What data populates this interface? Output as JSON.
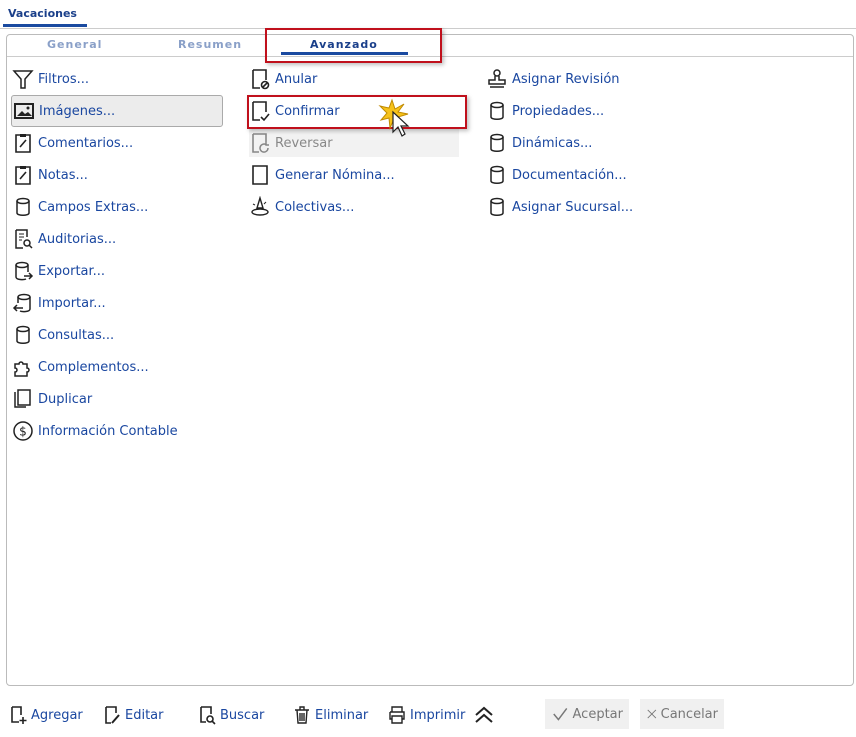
{
  "window_tab": "Vacaciones",
  "tabs": [
    {
      "label": "General"
    },
    {
      "label": "Resumen"
    },
    {
      "label": "Avanzado",
      "active": true
    }
  ],
  "col1": [
    {
      "label": "Filtros...",
      "icon": "filter-icon"
    },
    {
      "label": "Imágenes...",
      "icon": "image-icon"
    },
    {
      "label": "Comentarios...",
      "icon": "clipboard-icon"
    },
    {
      "label": "Notas...",
      "icon": "clipboard-icon"
    },
    {
      "label": "Campos Extras...",
      "icon": "database-icon"
    },
    {
      "label": "Auditorias...",
      "icon": "audit-icon"
    },
    {
      "label": "Exportar...",
      "icon": "database-export-icon"
    },
    {
      "label": "Importar...",
      "icon": "database-import-icon"
    },
    {
      "label": "Consultas...",
      "icon": "database-icon"
    },
    {
      "label": "Complementos...",
      "icon": "puzzle-icon"
    },
    {
      "label": "Duplicar",
      "icon": "copy-icon"
    },
    {
      "label": "Información Contable",
      "icon": "dollar-icon"
    }
  ],
  "col2": [
    {
      "label": "Anular",
      "icon": "document-cancel-icon"
    },
    {
      "label": "Confirmar",
      "icon": "document-check-icon"
    },
    {
      "label": "Reversar",
      "icon": "document-revert-icon",
      "disabled": true
    },
    {
      "label": "Generar Nómina...",
      "icon": "document-icon"
    },
    {
      "label": "Colectivas...",
      "icon": "wizard-icon"
    }
  ],
  "col3": [
    {
      "label": "Asignar Revisión",
      "icon": "stamp-icon"
    },
    {
      "label": "Propiedades...",
      "icon": "database-icon"
    },
    {
      "label": "Dinámicas...",
      "icon": "database-icon"
    },
    {
      "label": "Documentación...",
      "icon": "database-icon"
    },
    {
      "label": "Asignar Sucursal...",
      "icon": "database-icon"
    }
  ],
  "toolbar": {
    "add": "Agregar",
    "edit": "Editar",
    "search": "Buscar",
    "delete": "Eliminar",
    "print": "Imprimir",
    "accept": "Aceptar",
    "cancel": "Cancelar"
  },
  "colors": {
    "accent": "#1a47a0",
    "highlight": "#c0101c"
  }
}
